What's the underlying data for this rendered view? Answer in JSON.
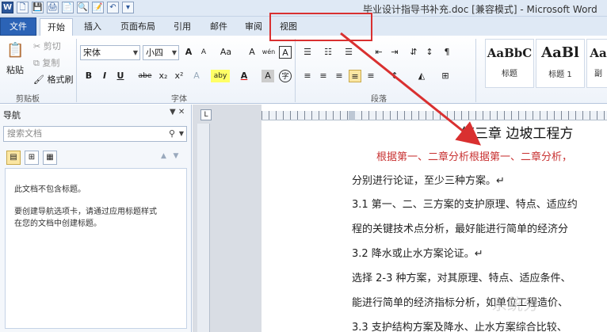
{
  "window": {
    "title": "毕业设计指导书补充.doc [兼容模式] - Microsoft Word"
  },
  "quick_access": [
    "W",
    "🗋",
    "💾",
    "🖨",
    "📄",
    "🔍",
    "📝",
    "↶",
    "▾"
  ],
  "tabs": [
    "文件",
    "开始",
    "插入",
    "页面布局",
    "引用",
    "邮件",
    "审阅",
    "视图"
  ],
  "clipboard": {
    "paste": "粘贴",
    "cut": "剪切",
    "copy": "复制",
    "format_painter": "格式刷",
    "label": "剪贴板"
  },
  "font": {
    "name": "宋体",
    "size": "小四",
    "grow": "A",
    "shrink": "A",
    "case": "Aa",
    "clear": "A",
    "phonetic": "wén",
    "border": "A",
    "bold": "B",
    "italic": "I",
    "underline": "U",
    "strike": "abe",
    "sub": "x₂",
    "sup": "x²",
    "effects": "A",
    "highlight": "aby",
    "color": "A",
    "shade": "A",
    "enclose": "字",
    "label": "字体"
  },
  "paragraph": {
    "label": "段落"
  },
  "styles": [
    {
      "sample": "AaBbC",
      "name": "标题"
    },
    {
      "sample": "AaBl",
      "name": "标题 1"
    },
    {
      "sample": "Aa",
      "name": "副"
    }
  ],
  "nav": {
    "title": "导航",
    "search_placeholder": "搜索文档",
    "msg1": "此文档不包含标题。",
    "msg2_line1": "要创建导航选项卡，请通过应用标题样式",
    "msg2_line2": "在您的文档中创建标题。"
  },
  "doc": {
    "chapter": "第三章   边坡工程方",
    "red_line": "根据第一、二章分析根据第一、二章分析，",
    "line1": "分别进行论证，至少三种方案。↵",
    "line2": "3.1  第一、二、三方案的支护原理、特点、适应约",
    "line3": "程的关键技术点分析，最好能进行简单的经济分",
    "line4": "3.2  降水或止水方案论证。↵",
    "line5": "选择 2-3 种方案，对其原理、特点、适应条件、",
    "line6": "能进行简单的经济指标分析，如单位工程造价、",
    "line7": "3.3  支护结构方案及降水、止水方案综合比较、"
  },
  "watermark": "系统分",
  "colors": {
    "accent": "#2b63b6",
    "highlight": "#d93030",
    "red_text": "#c83232"
  }
}
